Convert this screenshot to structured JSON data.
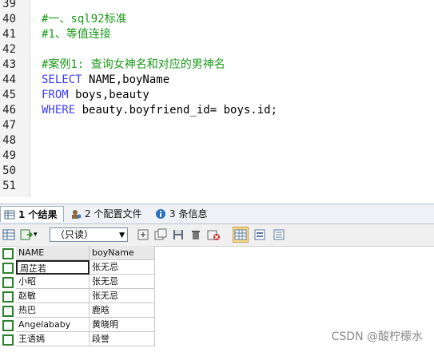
{
  "editor": {
    "lines": [
      {
        "num": "39",
        "parts": [
          {
            "t": "",
            "c": ""
          }
        ]
      },
      {
        "num": "40",
        "parts": [
          {
            "t": "#一、sql92标准",
            "c": "cm"
          }
        ]
      },
      {
        "num": "41",
        "parts": [
          {
            "t": "#1、等值连接",
            "c": "cm"
          }
        ]
      },
      {
        "num": "42",
        "parts": [
          {
            "t": "",
            "c": ""
          }
        ]
      },
      {
        "num": "43",
        "parts": [
          {
            "t": "#案例1: 查询女神名和对应的男神名",
            "c": "cm"
          }
        ]
      },
      {
        "num": "44",
        "parts": [
          {
            "t": "SELECT",
            "c": "kw"
          },
          {
            "t": " NAME,boyName",
            "c": ""
          }
        ]
      },
      {
        "num": "45",
        "parts": [
          {
            "t": "FROM",
            "c": "kw"
          },
          {
            "t": " boys,beauty",
            "c": ""
          }
        ]
      },
      {
        "num": "46",
        "parts": [
          {
            "t": "WHERE",
            "c": "kw"
          },
          {
            "t": " beauty.boyfriend_id= boys.id;",
            "c": ""
          }
        ]
      },
      {
        "num": "47",
        "parts": [
          {
            "t": "",
            "c": ""
          }
        ]
      },
      {
        "num": "48",
        "parts": [
          {
            "t": "",
            "c": ""
          }
        ]
      },
      {
        "num": "49",
        "parts": [
          {
            "t": "",
            "c": ""
          }
        ]
      },
      {
        "num": "50",
        "parts": [
          {
            "t": "",
            "c": ""
          }
        ]
      },
      {
        "num": "51",
        "parts": [
          {
            "t": "",
            "c": ""
          }
        ]
      }
    ]
  },
  "tabs": [
    {
      "label": "1 个结果",
      "icon": "grid-icon",
      "active": true
    },
    {
      "label": "2 个配置文件",
      "icon": "profile-icon",
      "active": false
    },
    {
      "label": "3 条信息",
      "icon": "info-icon",
      "active": false
    }
  ],
  "toolbar": {
    "mode_value": "（只读）"
  },
  "grid": {
    "columns": [
      "NAME",
      "boyName"
    ],
    "rows": [
      [
        "周芷若",
        "张无忌"
      ],
      [
        "小昭",
        "张无忌"
      ],
      [
        "赵敏",
        "张无忌"
      ],
      [
        "热巴",
        "鹿晗"
      ],
      [
        "Angelababy",
        "黄晓明"
      ],
      [
        "王语嫣",
        "段誉"
      ]
    ]
  },
  "watermark": "CSDN @酸柠檬水",
  "colors": {
    "comment": "#1c9a1c",
    "keyword": "#3c3cff",
    "checkbox": "#2e7d32"
  }
}
